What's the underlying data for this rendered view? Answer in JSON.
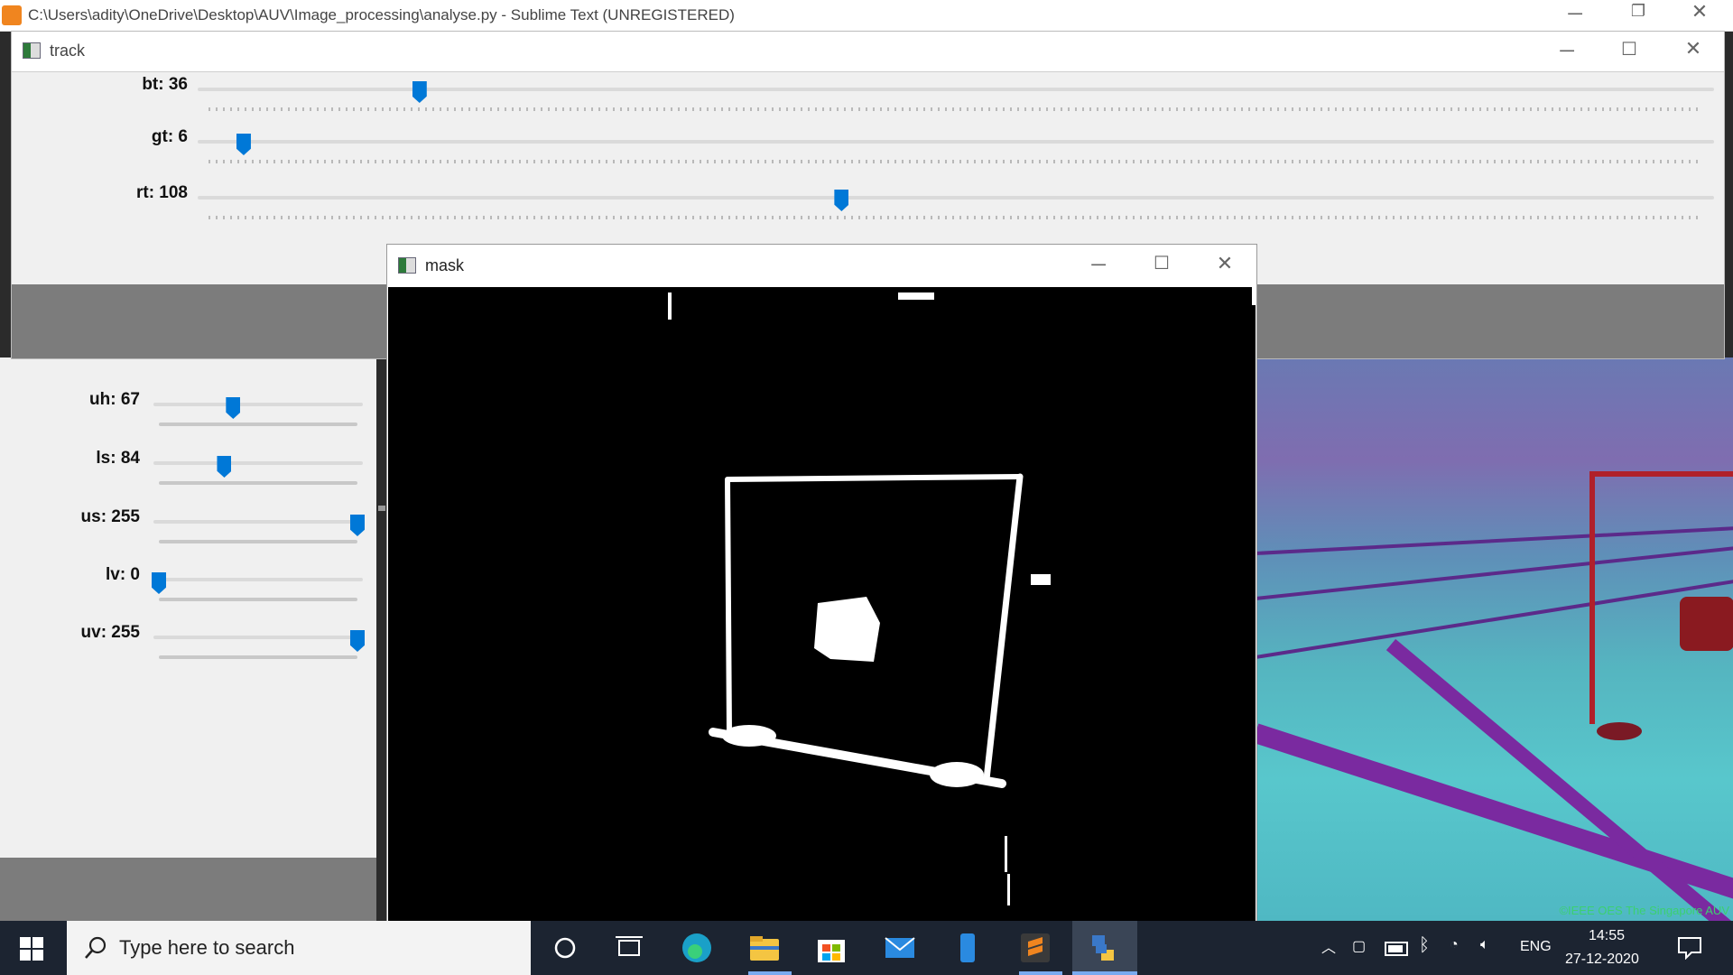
{
  "sublime": {
    "title": "C:\\Users\\adity\\OneDrive\\Desktop\\AUV\\Image_processing\\analyse.py - Sublime Text (UNREGISTERED)",
    "icon": "sublime-logo-icon"
  },
  "track_window": {
    "title": "track",
    "sliders": [
      {
        "label": "bt: 36",
        "value": 36,
        "max": 255
      },
      {
        "label": "gt: 6",
        "value": 6,
        "max": 255
      },
      {
        "label": "rt: 108",
        "value": 108,
        "max": 255
      }
    ]
  },
  "hsv_panel": {
    "sliders": [
      {
        "label": "uh: 67",
        "value": 67,
        "max": 179
      },
      {
        "label": "ls: 84",
        "value": 84,
        "max": 255
      },
      {
        "label": "us: 255",
        "value": 255,
        "max": 255
      },
      {
        "label": "lv: 0",
        "value": 0,
        "max": 255
      },
      {
        "label": "uv: 255",
        "value": 255,
        "max": 255
      }
    ]
  },
  "mask_window": {
    "title": "mask"
  },
  "pool_credit": "©IEEE OES The Singapore AUV",
  "taskbar": {
    "search_placeholder": "Type here to search",
    "language": "ENG",
    "time": "14:55",
    "date": "27-12-2020"
  },
  "colors": {
    "slider_thumb": "#0078d7",
    "taskbar": "#1c2431",
    "sublime": "#f0851f"
  }
}
